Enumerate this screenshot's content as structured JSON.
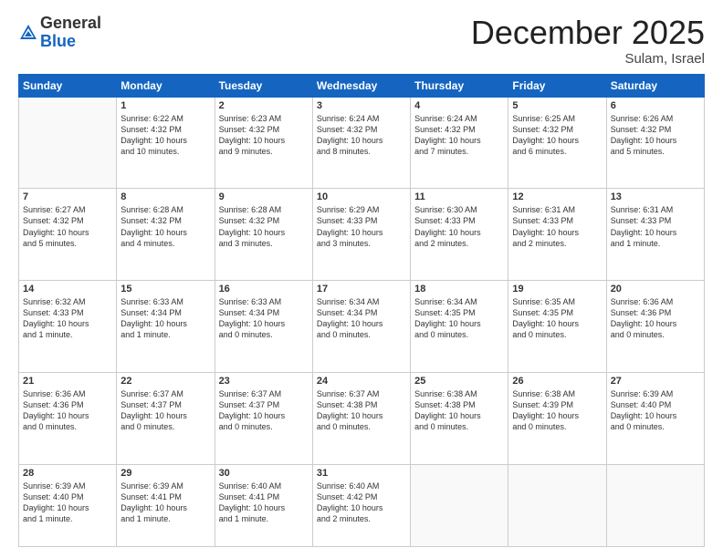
{
  "logo": {
    "general": "General",
    "blue": "Blue"
  },
  "header": {
    "month": "December 2025",
    "location": "Sulam, Israel"
  },
  "weekdays": [
    "Sunday",
    "Monday",
    "Tuesday",
    "Wednesday",
    "Thursday",
    "Friday",
    "Saturday"
  ],
  "weeks": [
    [
      {
        "day": "",
        "info": ""
      },
      {
        "day": "1",
        "info": "Sunrise: 6:22 AM\nSunset: 4:32 PM\nDaylight: 10 hours\nand 10 minutes."
      },
      {
        "day": "2",
        "info": "Sunrise: 6:23 AM\nSunset: 4:32 PM\nDaylight: 10 hours\nand 9 minutes."
      },
      {
        "day": "3",
        "info": "Sunrise: 6:24 AM\nSunset: 4:32 PM\nDaylight: 10 hours\nand 8 minutes."
      },
      {
        "day": "4",
        "info": "Sunrise: 6:24 AM\nSunset: 4:32 PM\nDaylight: 10 hours\nand 7 minutes."
      },
      {
        "day": "5",
        "info": "Sunrise: 6:25 AM\nSunset: 4:32 PM\nDaylight: 10 hours\nand 6 minutes."
      },
      {
        "day": "6",
        "info": "Sunrise: 6:26 AM\nSunset: 4:32 PM\nDaylight: 10 hours\nand 5 minutes."
      }
    ],
    [
      {
        "day": "7",
        "info": "Sunrise: 6:27 AM\nSunset: 4:32 PM\nDaylight: 10 hours\nand 5 minutes."
      },
      {
        "day": "8",
        "info": "Sunrise: 6:28 AM\nSunset: 4:32 PM\nDaylight: 10 hours\nand 4 minutes."
      },
      {
        "day": "9",
        "info": "Sunrise: 6:28 AM\nSunset: 4:32 PM\nDaylight: 10 hours\nand 3 minutes."
      },
      {
        "day": "10",
        "info": "Sunrise: 6:29 AM\nSunset: 4:33 PM\nDaylight: 10 hours\nand 3 minutes."
      },
      {
        "day": "11",
        "info": "Sunrise: 6:30 AM\nSunset: 4:33 PM\nDaylight: 10 hours\nand 2 minutes."
      },
      {
        "day": "12",
        "info": "Sunrise: 6:31 AM\nSunset: 4:33 PM\nDaylight: 10 hours\nand 2 minutes."
      },
      {
        "day": "13",
        "info": "Sunrise: 6:31 AM\nSunset: 4:33 PM\nDaylight: 10 hours\nand 1 minute."
      }
    ],
    [
      {
        "day": "14",
        "info": "Sunrise: 6:32 AM\nSunset: 4:33 PM\nDaylight: 10 hours\nand 1 minute."
      },
      {
        "day": "15",
        "info": "Sunrise: 6:33 AM\nSunset: 4:34 PM\nDaylight: 10 hours\nand 1 minute."
      },
      {
        "day": "16",
        "info": "Sunrise: 6:33 AM\nSunset: 4:34 PM\nDaylight: 10 hours\nand 0 minutes."
      },
      {
        "day": "17",
        "info": "Sunrise: 6:34 AM\nSunset: 4:34 PM\nDaylight: 10 hours\nand 0 minutes."
      },
      {
        "day": "18",
        "info": "Sunrise: 6:34 AM\nSunset: 4:35 PM\nDaylight: 10 hours\nand 0 minutes."
      },
      {
        "day": "19",
        "info": "Sunrise: 6:35 AM\nSunset: 4:35 PM\nDaylight: 10 hours\nand 0 minutes."
      },
      {
        "day": "20",
        "info": "Sunrise: 6:36 AM\nSunset: 4:36 PM\nDaylight: 10 hours\nand 0 minutes."
      }
    ],
    [
      {
        "day": "21",
        "info": "Sunrise: 6:36 AM\nSunset: 4:36 PM\nDaylight: 10 hours\nand 0 minutes."
      },
      {
        "day": "22",
        "info": "Sunrise: 6:37 AM\nSunset: 4:37 PM\nDaylight: 10 hours\nand 0 minutes."
      },
      {
        "day": "23",
        "info": "Sunrise: 6:37 AM\nSunset: 4:37 PM\nDaylight: 10 hours\nand 0 minutes."
      },
      {
        "day": "24",
        "info": "Sunrise: 6:37 AM\nSunset: 4:38 PM\nDaylight: 10 hours\nand 0 minutes."
      },
      {
        "day": "25",
        "info": "Sunrise: 6:38 AM\nSunset: 4:38 PM\nDaylight: 10 hours\nand 0 minutes."
      },
      {
        "day": "26",
        "info": "Sunrise: 6:38 AM\nSunset: 4:39 PM\nDaylight: 10 hours\nand 0 minutes."
      },
      {
        "day": "27",
        "info": "Sunrise: 6:39 AM\nSunset: 4:40 PM\nDaylight: 10 hours\nand 0 minutes."
      }
    ],
    [
      {
        "day": "28",
        "info": "Sunrise: 6:39 AM\nSunset: 4:40 PM\nDaylight: 10 hours\nand 1 minute."
      },
      {
        "day": "29",
        "info": "Sunrise: 6:39 AM\nSunset: 4:41 PM\nDaylight: 10 hours\nand 1 minute."
      },
      {
        "day": "30",
        "info": "Sunrise: 6:40 AM\nSunset: 4:41 PM\nDaylight: 10 hours\nand 1 minute."
      },
      {
        "day": "31",
        "info": "Sunrise: 6:40 AM\nSunset: 4:42 PM\nDaylight: 10 hours\nand 2 minutes."
      },
      {
        "day": "",
        "info": ""
      },
      {
        "day": "",
        "info": ""
      },
      {
        "day": "",
        "info": ""
      }
    ]
  ]
}
